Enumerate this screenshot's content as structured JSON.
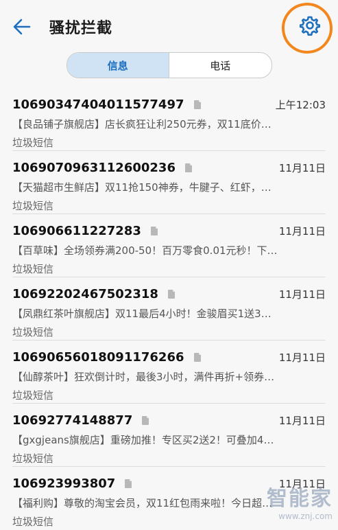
{
  "header": {
    "title": "骚扰拦截",
    "back_icon": "arrow-left-icon",
    "settings_icon": "gear-icon"
  },
  "tabs": [
    {
      "label": "信息",
      "active": true
    },
    {
      "label": "电话",
      "active": false
    }
  ],
  "messages": [
    {
      "number": "10690347404011577497",
      "time": "上午12:03",
      "preview": "【良品铺子旗舰店】店长疯狂让利250元券，双11底价…",
      "tag": "垃圾短信"
    },
    {
      "number": "1069070963112600236",
      "time": "11月11日",
      "preview": "【天猫超市生鲜店】双11抢150神券，牛腱子、红虾，…",
      "tag": "垃圾短信"
    },
    {
      "number": "106906611227283",
      "time": "11月11日",
      "preview": "【百草味】全场领券满200-50！百万零食0.01元秒！下…",
      "tag": "垃圾短信"
    },
    {
      "number": "10692202467502318",
      "time": "11月11日",
      "preview": "【凤鼎红茶叶旗舰店】双11最后4小时！金骏眉买1送3…",
      "tag": "垃圾短信"
    },
    {
      "number": "10690656018091176266",
      "time": "11月11日",
      "preview": "【仙醇茶叶】狂欢倒计时，最後3小时，满件再折+领券…",
      "tag": "垃圾短信"
    },
    {
      "number": "10692774148877",
      "time": "11月11日",
      "preview": "【gxgjeans旗舰店】重磅加推！专区买2送2！可叠加4…",
      "tag": "垃圾短信"
    },
    {
      "number": "106923993807",
      "time": "11月11日",
      "preview": "【福利购】尊敬的淘宝会员，双11红包雨来啦！今日超…",
      "tag": "垃圾短信"
    }
  ],
  "watermark": {
    "brand": "智能家",
    "url": "www.znj.com"
  },
  "colors": {
    "accent": "#1f6fbf",
    "annotation": "#f2871e",
    "tab_active_bg": "#cfe3f5"
  }
}
